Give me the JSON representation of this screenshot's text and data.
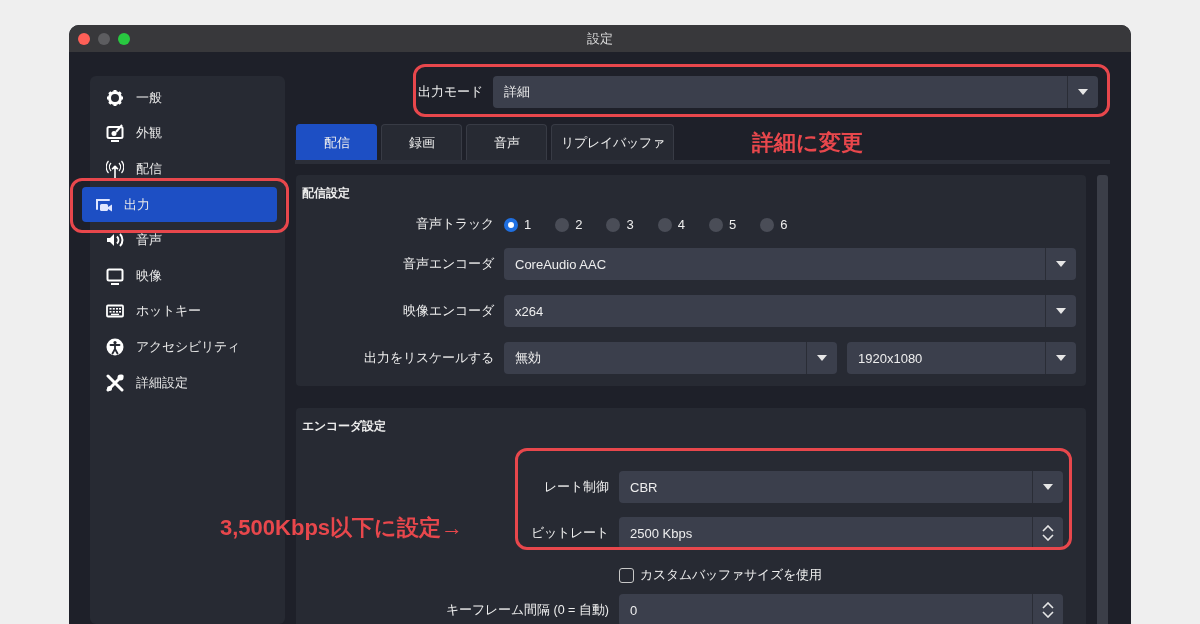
{
  "window": {
    "title": "設定"
  },
  "sidebar": {
    "items": [
      {
        "label": "一般",
        "selected": false
      },
      {
        "label": "外観",
        "selected": false
      },
      {
        "label": "配信",
        "selected": false
      },
      {
        "label": "出力",
        "selected": true
      },
      {
        "label": "音声",
        "selected": false
      },
      {
        "label": "映像",
        "selected": false
      },
      {
        "label": "ホットキー",
        "selected": false
      },
      {
        "label": "アクセシビリティ",
        "selected": false
      },
      {
        "label": "詳細設定",
        "selected": false
      }
    ]
  },
  "output_mode": {
    "label": "出力モード",
    "value": "詳細"
  },
  "tabs": [
    {
      "label": "配信",
      "selected": true
    },
    {
      "label": "録画",
      "selected": false
    },
    {
      "label": "音声",
      "selected": false
    },
    {
      "label": "リプレイバッファ",
      "selected": false
    }
  ],
  "sections": [
    {
      "title": "配信設定",
      "rows": [
        {
          "kind": "radio",
          "label": "音声トラック",
          "options": [
            {
              "label": "1",
              "selected": true
            },
            {
              "label": "2",
              "selected": false
            },
            {
              "label": "3",
              "selected": false
            },
            {
              "label": "4",
              "selected": false
            },
            {
              "label": "5",
              "selected": false
            },
            {
              "label": "6",
              "selected": false
            }
          ]
        },
        {
          "kind": "combo",
          "label": "音声エンコーダ",
          "value": "CoreAudio AAC"
        },
        {
          "kind": "combo",
          "label": "映像エンコーダ",
          "value": "x264"
        },
        {
          "kind": "combo_pair",
          "label": "出力をリスケールする",
          "value": "無効",
          "value_2": "1920x1080"
        }
      ]
    },
    {
      "title": "エンコーダ設定",
      "rows": [
        {
          "kind": "combo",
          "label": "レート制御",
          "value": "CBR"
        },
        {
          "kind": "spin",
          "label": "ビットレート",
          "value": "2500 Kbps"
        },
        {
          "kind": "checkbox",
          "label": "カスタムバッファサイズを使用",
          "checked": false
        },
        {
          "kind": "spin",
          "label": "キーフレーム間隔 (0 = 自動)",
          "value": "0"
        }
      ]
    }
  ],
  "annotations": [
    {
      "text": "詳細に変更"
    },
    {
      "text": "3,500Kbps以下に設定→"
    }
  ]
}
